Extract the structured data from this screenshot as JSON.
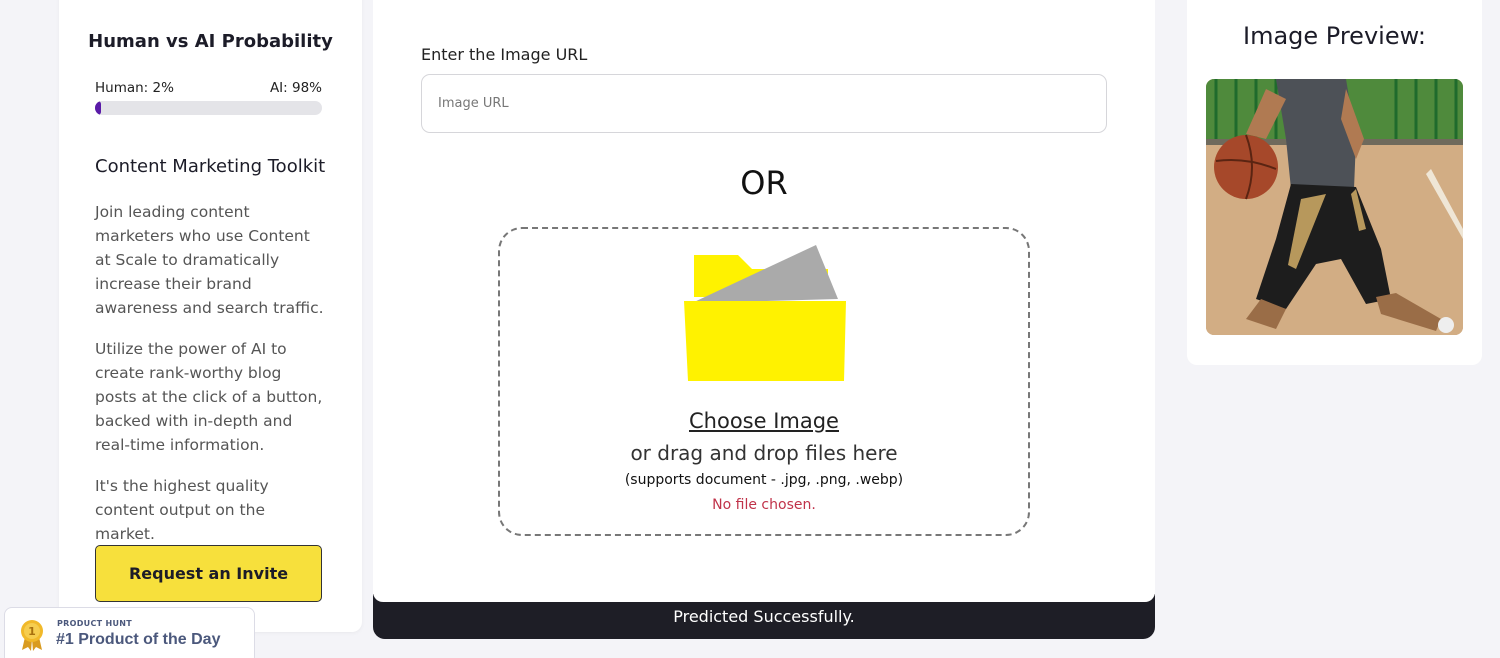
{
  "probability": {
    "title": "Human vs AI Probability",
    "human_label": "Human: 2%",
    "ai_label": "AI: 98%",
    "human_fraction": 0.02,
    "bar_color": "#5a1ba8"
  },
  "toolkit": {
    "title": "Content Marketing Toolkit",
    "paragraphs": [
      "Join leading content marketers who use Content at Scale to dramatically increase their brand awareness and search traffic.",
      "Utilize the power of AI to create rank-worthy blog posts at the click of a button, backed with in-depth and real-time information.",
      "It's the highest quality content output on the market."
    ],
    "invite_button": "Request an Invite"
  },
  "upload": {
    "url_label": "Enter the Image URL",
    "url_placeholder": "Image URL",
    "url_value": "",
    "or_text": "OR",
    "choose_image": "Choose Image",
    "drag_text": "or drag and drop files here",
    "supports_text": "(supports document - .jpg, .png, .webp)",
    "no_file_text": "No file chosen.",
    "folder_color": "#fff200"
  },
  "status": {
    "message": "Predicted Successfully."
  },
  "preview": {
    "title": "Image Preview:"
  },
  "product_hunt": {
    "small_label": "PRODUCT HUNT",
    "big_label": "#1 Product of the Day"
  }
}
